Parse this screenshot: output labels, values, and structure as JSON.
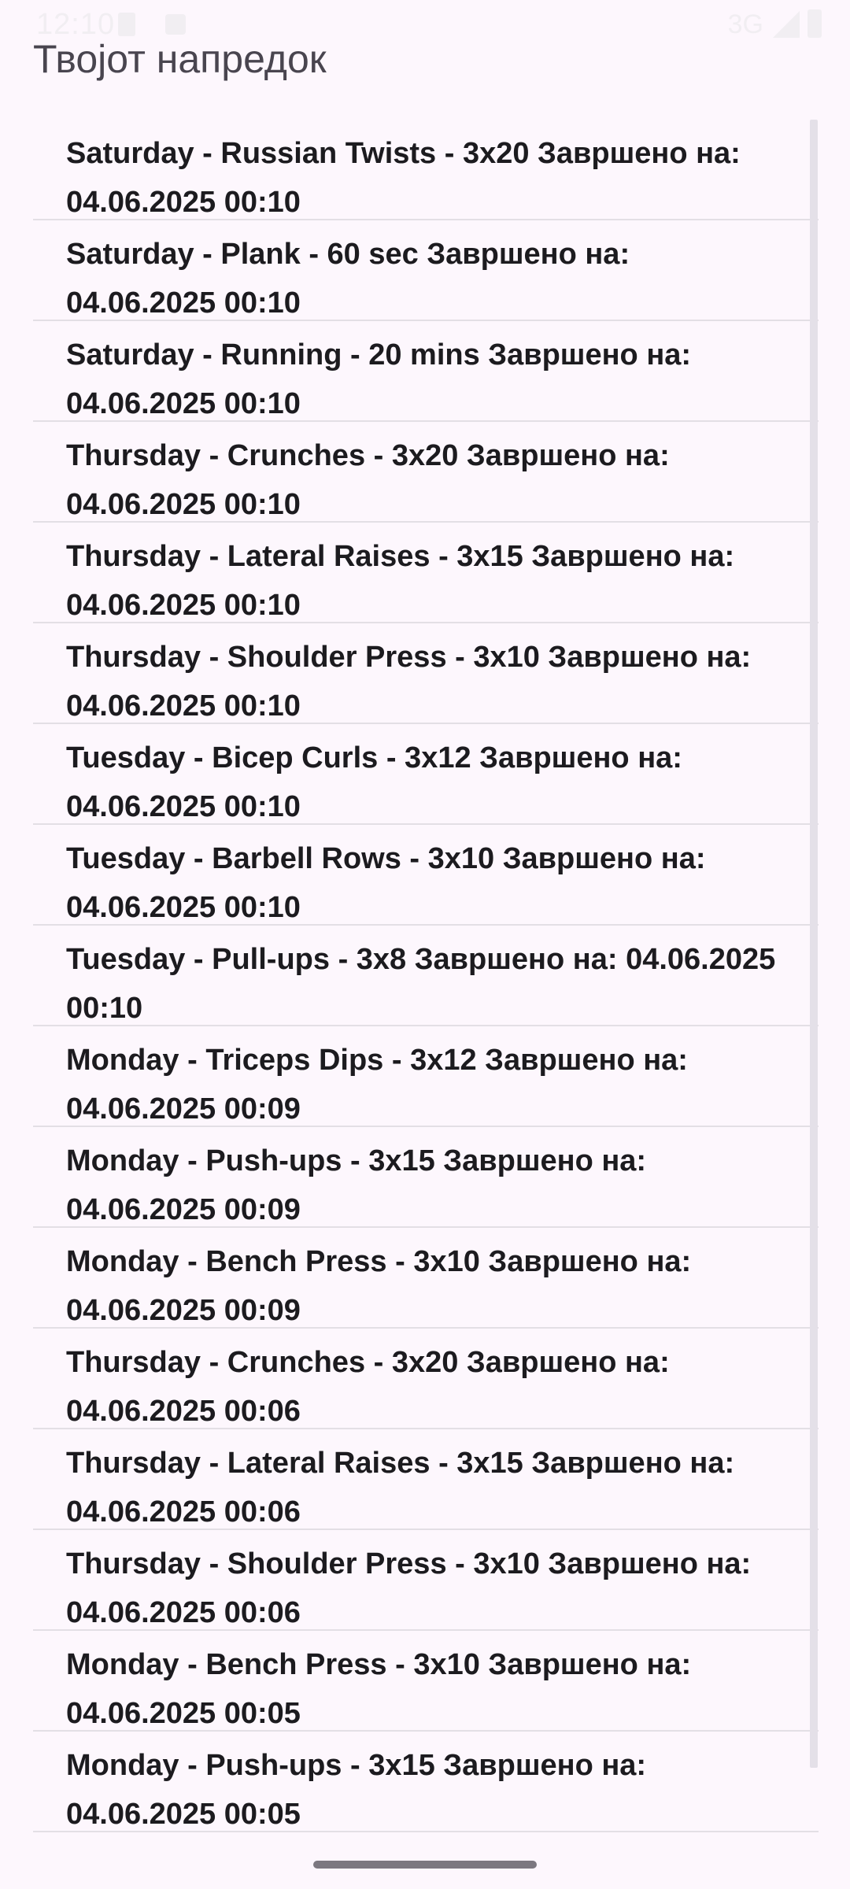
{
  "status_bar": {
    "time": "12:10",
    "network": "3G"
  },
  "header": {
    "title": "Твојот напредок"
  },
  "progress_list": {
    "items": [
      {
        "label": "Saturday - Russian Twists - 3x20 Завршено на: 04.06.2025 00:10"
      },
      {
        "label": "Saturday - Plank - 60 sec Завршено на: 04.06.2025 00:10"
      },
      {
        "label": "Saturday - Running - 20 mins Завршено на: 04.06.2025 00:10"
      },
      {
        "label": "Thursday - Crunches - 3x20 Завршено на: 04.06.2025 00:10"
      },
      {
        "label": "Thursday - Lateral Raises - 3x15 Завршено на: 04.06.2025 00:10"
      },
      {
        "label": "Thursday - Shoulder Press - 3x10 Завршено на: 04.06.2025 00:10"
      },
      {
        "label": "Tuesday - Bicep Curls - 3x12 Завршено на: 04.06.2025 00:10"
      },
      {
        "label": "Tuesday - Barbell Rows - 3x10 Завршено на: 04.06.2025 00:10"
      },
      {
        "label": "Tuesday - Pull-ups - 3x8 Завршено на: 04.06.2025 00:10"
      },
      {
        "label": "Monday - Triceps Dips - 3x12 Завршено на: 04.06.2025 00:09"
      },
      {
        "label": "Monday - Push-ups - 3x15 Завршено на: 04.06.2025 00:09"
      },
      {
        "label": "Monday - Bench Press - 3x10 Завршено на: 04.06.2025 00:09"
      },
      {
        "label": "Thursday - Crunches - 3x20 Завршено на: 04.06.2025 00:06"
      },
      {
        "label": "Thursday - Lateral Raises - 3x15 Завршено на: 04.06.2025 00:06"
      },
      {
        "label": "Thursday - Shoulder Press - 3x10 Завршено на: 04.06.2025 00:06"
      },
      {
        "label": "Monday - Bench Press - 3x10 Завршено на: 04.06.2025 00:05"
      },
      {
        "label": "Monday - Push-ups - 3x15 Завршено на: 04.06.2025 00:05"
      }
    ]
  },
  "colors": {
    "background": "#fdf7fd",
    "text": "#1c1b1f",
    "title": "#49454f",
    "divider": "#e3dfe5"
  }
}
